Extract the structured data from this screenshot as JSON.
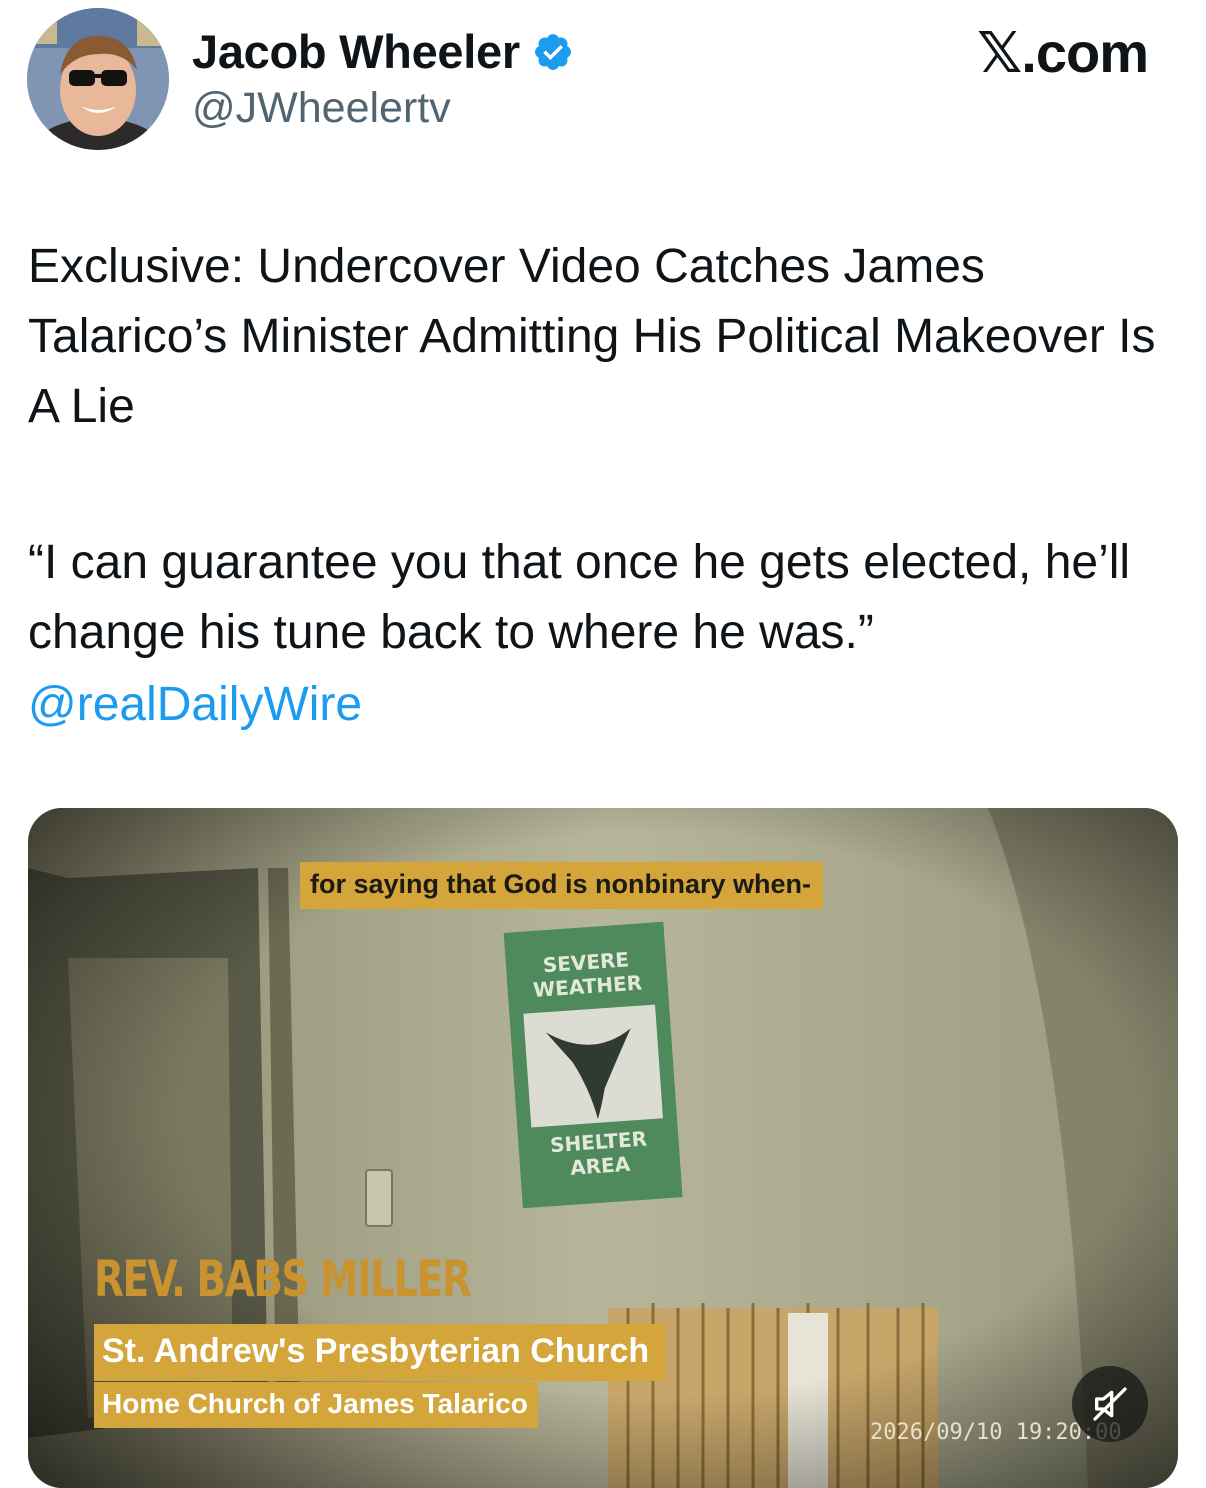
{
  "author": {
    "display_name": "Jacob Wheeler",
    "handle": "@JWheelertv",
    "verified_icon": "verified-badge-icon"
  },
  "brand": "𝕏.com",
  "tweet": {
    "paragraph1": "Exclusive: Undercover Video Catches James Talarico’s Minister Admitting His Political Makeover Is A Lie",
    "paragraph2": "“I can guarantee you that once he gets elected, he’ll change his tune back to where he was.”",
    "mention": "@realDailyWire"
  },
  "media": {
    "caption": "for saying that God is nonbinary when-",
    "sign_top": "SEVERE WEATHER",
    "sign_bottom": "SHELTER AREA",
    "name_lower_third": "REV. BABS MILLER",
    "church_line": "St. Andrew's Presbyterian Church",
    "home_church_line": "Home Church of James Talarico",
    "timestamp": "2026/09/10 19:20:00",
    "mute_icon": "speaker-muted-icon"
  },
  "colors": {
    "link": "#1d9bf0",
    "verified": "#1d9bf0",
    "lower_third": "#d4a53a",
    "secondary_text": "#536471"
  }
}
